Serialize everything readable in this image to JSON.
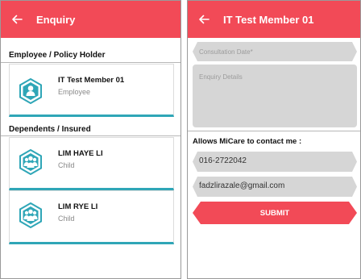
{
  "left_screen": {
    "title": "Enquiry",
    "employee_section_title": "Employee / Policy Holder",
    "employee": {
      "name": "IT Test Member 01",
      "role": "Employee"
    },
    "dependents_section_title": "Dependents / Insured",
    "dependents": [
      {
        "name": "LIM HAYE LI",
        "role": "Child"
      },
      {
        "name": "LIM RYE LI",
        "role": "Child"
      }
    ]
  },
  "right_screen": {
    "title": "IT Test Member 01",
    "consultation_date_placeholder": "Consultation Date*",
    "enquiry_details_placeholder": "Enquiry Details",
    "contact_label": "Allows MiCare to contact me :",
    "phone": "016-2722042",
    "email": "fadzlirazale@gmail.com",
    "submit_label": "SUBMIT"
  },
  "colors": {
    "header": "#f24a57",
    "accent_teal": "#2fa6b7",
    "field_bg": "#d6d6d6"
  },
  "icons": {
    "back": "arrow-left-icon",
    "employee": "person-hexagon-icon",
    "dependent": "group-hexagon-icon"
  }
}
